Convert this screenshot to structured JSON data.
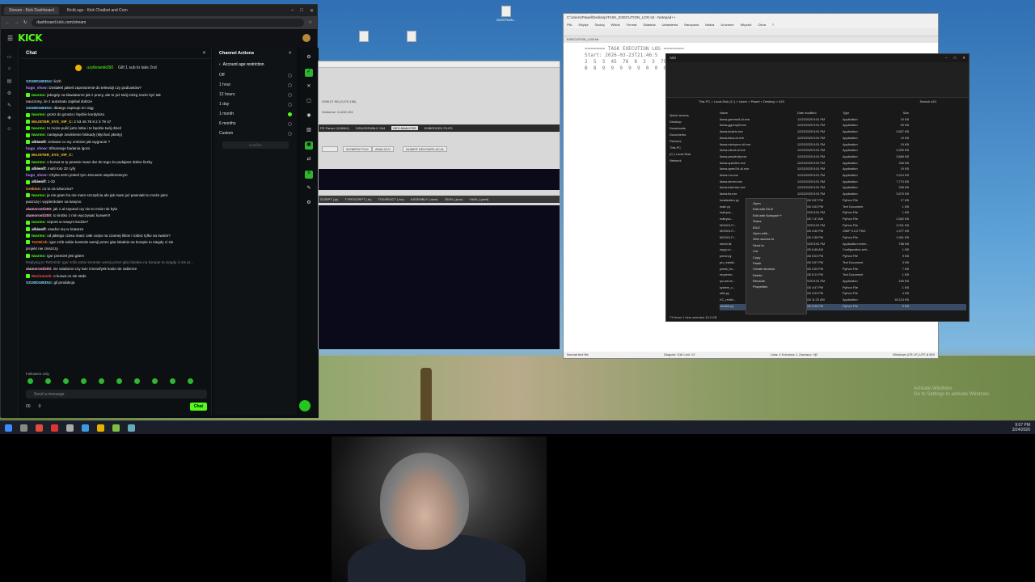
{
  "browser": {
    "tabs": [
      "Stream - Kick Dashboard",
      "KickLogs - Kick Chatbot and Com"
    ],
    "url": "dashboard.kick.com/stream",
    "logo": "KICK"
  },
  "chat": {
    "title": "Chat",
    "gift_user": "uzytkownik090",
    "gift_text": "Gift 1 sub to take 2nd",
    "messages": [
      {
        "user": "SZUBDUBIDUI:",
        "text": "liczb",
        "color": "#7fd3ff",
        "badge": false
      },
      {
        "user": "hugo_show:",
        "text": "Dostałeś jakieś zaproszenie do telewizji czy podcastów?",
        "color": "#b58cff",
        "badge": false
      },
      {
        "user": "twarmo:",
        "text": "jakogdy na klawiaturze jak z pracy, ale to już twój mózg może być tak",
        "color": "#53fc18",
        "badge": true
      },
      {
        "user": "",
        "text": "nauczony, że z automatu zajebał dobrze",
        "color": "#e6e6e6",
        "badge": false
      },
      {
        "user": "SZUBDUBIDUI:",
        "text": "dlatego zapisuje im ciąg",
        "color": "#7fd3ff",
        "badge": false
      },
      {
        "user": "twarmo:",
        "text": "grosz do grosza i będzie kordyloza",
        "color": "#53fc18",
        "badge": true
      },
      {
        "user": "MAJSTER_SYS_VIP_C:",
        "text": "2 53 45 78 8 2 3 79 47",
        "color": "#ffcc33",
        "badge": true
      },
      {
        "user": "twarmo:",
        "text": "to może pulić jutro lotka i to będzie twój dzień",
        "color": "#53fc18",
        "badge": true
      },
      {
        "user": "twarmo:",
        "text": "następuje zwolnienie blokady (słychać płonty)",
        "color": "#53fc18",
        "badge": true
      },
      {
        "user": "albiwolf:",
        "text": "ciekawe co wy zrobicie jak wygracie ?",
        "color": "#ffffff",
        "badge": true
      },
      {
        "user": "hugo_show:",
        "text": "Sfinansuje badania lgora",
        "color": "#b58cff",
        "badge": false
      },
      {
        "user": "MAJSTER_SYS_VIP_C:",
        "text": "",
        "color": "#ffcc33",
        "badge": true
      },
      {
        "user": "twarmo:",
        "text": "o kurwa to ty pewnie masz dar do tego że podajesz dobre liczby",
        "color": "#53fc18",
        "badge": true
      },
      {
        "user": "albiwolf:",
        "text": "multi toto 32 cyfy",
        "color": "#ffffff",
        "badge": true
      },
      {
        "user": "hugo_show:",
        "text": "Chyba serio jesteś tym Jezusem współczesnym",
        "color": "#b58cff",
        "badge": false
      },
      {
        "user": "albiwolf:",
        "text": "1-32",
        "color": "#ffffff",
        "badge": true
      },
      {
        "user": "Grebion:",
        "text": "co to za sztuczna?",
        "color": "#ff9d3d",
        "badge": false
      },
      {
        "user": "twarmo:",
        "text": "ja nie gram bo nie mam szczęścia ale jak mam już pewniaki to może jutro",
        "color": "#53fc18",
        "badge": true
      },
      {
        "user": "",
        "text": "puszczę i wyplerdolam na kasyno",
        "color": "#e6e6e6",
        "badge": false
      },
      {
        "user": "alamorosti200:",
        "text": "jak z.al szpond czy nie to mnie nie było",
        "color": "#ffb3d9",
        "badge": false
      },
      {
        "user": "alamorosti200:",
        "text": "to krotko z nim wyczywać kurwe!!!!",
        "color": "#ffb3d9",
        "badge": false
      },
      {
        "user": "twarmo:",
        "text": "szpont w nowym kodzie?",
        "color": "#53fc18",
        "badge": true
      },
      {
        "user": "albiwolf:",
        "text": "osadce się w kratarze",
        "color": "#ffffff",
        "badge": true
      },
      {
        "user": "twarmo:",
        "text": "od jakiego czasu masz całe corpo na czarnej liście i robisz tylko na swoim?",
        "color": "#53fc18",
        "badge": true
      },
      {
        "user": "ToOHiAb:",
        "text": "igor zrób sobie kontrole wersji przez gita lokalnie na kompie to niegdy ci sie",
        "color": "#ff7a2e",
        "badge": true
      },
      {
        "user": "",
        "text": "projekt nie zniszczy",
        "color": "#e6e6e6",
        "badge": false
      },
      {
        "user": "twarmo:",
        "text": "igor przeciet jest gitem",
        "color": "#53fc18",
        "badge": true
      },
      {
        "user": "",
        "text": "Replying to ToOHiAb: igor zrób sobie kontrole wersji przez gita lokalnie na kompie to niegdy ci sie pr...",
        "color": "#888888",
        "badge": false
      },
      {
        "user": "alamorosti200:",
        "text": "nie wiadomo czy tam microsfyek kodu nie zabierze",
        "color": "#ffb3d9",
        "badge": false
      },
      {
        "user": "Morisomek:",
        "text": "o kurwa co sie stało",
        "color": "#ff4d4d",
        "badge": true
      },
      {
        "user": "SZUBDUBIDUI:",
        "text": "gil produkcja",
        "color": "#7fd3ff",
        "badge": false
      }
    ],
    "followers_only": "Followers only",
    "input_placeholder": "Send a message",
    "viewers": "00",
    "count": "0",
    "send_label": "Chat"
  },
  "channel_actions": {
    "title": "Channel Actions",
    "subtitle": "Account age restriction",
    "options": [
      {
        "label": "Off",
        "selected": false
      },
      {
        "label": "1 hour",
        "selected": false
      },
      {
        "label": "12 hours",
        "selected": false
      },
      {
        "label": "1 day",
        "selected": false
      },
      {
        "label": "1 month",
        "selected": true
      },
      {
        "label": "6 months",
        "selected": false
      },
      {
        "label": "Custom",
        "selected": false
      }
    ],
    "confirm": "Confirm"
  },
  "disasm": {
    "field": "2998.07 KB (3,070,156)",
    "sections": "Sektorów: 11,632,104",
    "tabs": [
      "PE Parser (X/86/64)",
      "DISASSEMBLE X64",
      "HEX ANALYSIS",
      "EMBEDDED FILES"
    ],
    "buttons": [
      "WYBIERZ PLIK",
      "ANALIZUJ",
      "NUMER DEKOMPILACJA"
    ],
    "export_tabs": [
      "SCRIPT (.js)",
      "TYPESCRIPT (.ts)",
      "TSX/REACT (.tsx)",
      "ASSEMBLY (.asm)",
      "JSON (.json)",
      "YAML (.yaml)"
    ]
  },
  "notepad": {
    "title": "C:\\Users\\Pawel\\Desktop\\TASK_EXECUTION_LOG.txt - Notepad++",
    "menu": [
      "Plik",
      "Edycja",
      "Szukaj",
      "Widok",
      "Format",
      "Składnia",
      "Ustawienia",
      "Narzędzia",
      "Makra",
      "Uruchom",
      "Wtyczki",
      "Okna",
      "?"
    ],
    "tab": "EXECUTION_LOG.txt",
    "lines": [
      "======= TASK EXECUTION LOG =======",
      "Start: 2026-03-23T21:46:5",
      "2  5  3  45  78  8  2  3  79  47",
      "B  8  9  9  9  9  9  0  0  0"
    ],
    "status_left": "Normal text file",
    "status_mid": "Długość: 516   Linii: 13",
    "status_right": "Linia: 4   Kolumna: 1   Zaznacz: 0|0",
    "status_enc": "Windows (CR LF)   UTF-8   INS"
  },
  "explorer": {
    "title": "AGI",
    "path": "This PC  >  Local Disk (C:)  >  Users  >  Pawel  >  Desktop  >  AGI",
    "search": "Search AGI",
    "nav": [
      "Quick access",
      "Desktop",
      "Downloads",
      "Documents",
      "Pictures",
      "This PC",
      "(C:) Local Disk",
      "Network"
    ],
    "header": [
      "Name",
      "Date modified",
      "Type",
      "Size"
    ],
    "files": [
      {
        "name": "llama-gemma3-cli.exe",
        "date": "12/23/2025 5:51 PM",
        "type": "Application",
        "size": "19 KB"
      },
      {
        "name": "llama-gguf-split.exe",
        "date": "12/23/2025 5:51 PM",
        "type": "Application",
        "size": "59 KB"
      },
      {
        "name": "llama-imatrix.exe",
        "date": "12/23/2025 5:51 PM",
        "type": "Application",
        "size": "3,657 KB"
      },
      {
        "name": "llama-llava-cli.exe",
        "date": "12/23/2025 5:51 PM",
        "type": "Application",
        "size": "19 KB"
      },
      {
        "name": "llama-minicpmv-cli.exe",
        "date": "12/23/2025 5:51 PM",
        "type": "Application",
        "size": "19 KB"
      },
      {
        "name": "llama-mtmd-cli.exe",
        "date": "12/23/2025 5:51 PM",
        "type": "Application",
        "size": "3,390 KB"
      },
      {
        "name": "llama-perplexity.exe",
        "date": "12/23/2025 5:51 PM",
        "type": "Application",
        "size": "3,686 KB"
      },
      {
        "name": "llama-quantize.exe",
        "date": "12/23/2025 5:51 PM",
        "type": "Application",
        "size": "346 KB"
      },
      {
        "name": "llama-qwen2vl-cli.exe",
        "date": "12/23/2025 5:51 PM",
        "type": "Application",
        "size": "19 KB"
      },
      {
        "name": "llama-run.exe",
        "date": "12/23/2025 5:51 PM",
        "type": "Application",
        "size": "2,914 KB"
      },
      {
        "name": "llama-server.exe",
        "date": "12/23/2025 5:51 PM",
        "type": "Application",
        "size": "7,770 KB"
      },
      {
        "name": "llama-tokenize.exe",
        "date": "12/23/2025 5:51 PM",
        "type": "Application",
        "size": "298 KB"
      },
      {
        "name": "llama-tts.exe",
        "date": "12/23/2025 5:51 PM",
        "type": "Application",
        "size": "3,679 KB"
      },
      {
        "name": "localization.py",
        "date": "1/16/2026 5:57 PM",
        "type": "Python File",
        "size": "17 KB"
      },
      {
        "name": "main.py",
        "date": "1/16/2026 3:53 PM",
        "type": "Text Document",
        "size": "1 KB"
      },
      {
        "name": "matryca...",
        "date": "12/23/2025 5:51 PM",
        "type": "Python File",
        "size": "1 KB"
      },
      {
        "name": "matryca...",
        "date": "1/16/2026 7:47 AM",
        "type": "Python File",
        "size": "1,562 KB"
      },
      {
        "name": "MONOLIT...",
        "date": "12/23/2025 5:51 PM",
        "type": "Python File",
        "size": "2,031 KB"
      },
      {
        "name": "MONOLIT...",
        "date": "1/16/2026 4:40 PM",
        "type": "GIMP 3.0.2 PNG",
        "size": "1,977 KB"
      },
      {
        "name": "MONOLIT...",
        "date": "1/16/2026 2:38 PM",
        "type": "Python File",
        "size": "1,961 KB"
      },
      {
        "name": "mtmd.dll",
        "date": "12/23/2025 5:51 PM",
        "type": "Application exten...",
        "size": "768 KB"
      },
      {
        "name": "myyy.co...",
        "date": "1/16/2026 6:48 AM",
        "type": "Configuration sett...",
        "size": "1 KB"
      },
      {
        "name": "ponor.py",
        "date": "1/16/2026 5:03 PM",
        "type": "Python File",
        "size": "9 KB"
      },
      {
        "name": "pro_install...",
        "date": "1/16/2026 3:57 PM",
        "type": "Text Document",
        "size": "3 KB"
      },
      {
        "name": "portal_bo...",
        "date": "1/16/2026 3:00 PM",
        "type": "Python File",
        "size": "7 KB"
      },
      {
        "name": "requirem...",
        "date": "1/16/2026 5:11 PM",
        "type": "Text Document",
        "size": "1 KB"
      },
      {
        "name": "rpc-serve...",
        "date": "12/23/2025 5:51 PM",
        "type": "Application",
        "size": "169 KB"
      },
      {
        "name": "system_c...",
        "date": "1/16/2026 4:47 PM",
        "type": "Python File",
        "size": "1 KB"
      },
      {
        "name": "utils.py",
        "date": "1/16/2026 3:23 PM",
        "type": "Python File",
        "size": "4 KB"
      },
      {
        "name": "VC_redist...",
        "date": "1/16/2026 11:23 AM",
        "type": "Application",
        "size": "18,124 KB"
      },
      {
        "name": "zmodel.py",
        "date": "1/16/2026 3:48 PM",
        "type": "Python File",
        "size": "5 KB"
      }
    ],
    "status": "73 items    1 item selected  45.0 KB"
  },
  "context_menu": [
    "Open",
    "Edit with IDLE",
    "Edit with Notepad++",
    "Share",
    "IDLE",
    "Open with...",
    "Give access to",
    "Send to",
    "Cut",
    "Copy",
    "Paste",
    "Create shortcut",
    "Delete",
    "Rename",
    "Properties"
  ],
  "desktop": {
    "icons": [
      "2025TRAIN...",
      "...",
      "..."
    ],
    "watermark_1": "Activate Windows",
    "watermark_2": "Go to Settings to activate Windows."
  },
  "taskbar": {
    "time": "9:07 PM",
    "date": "3/24/2026"
  }
}
